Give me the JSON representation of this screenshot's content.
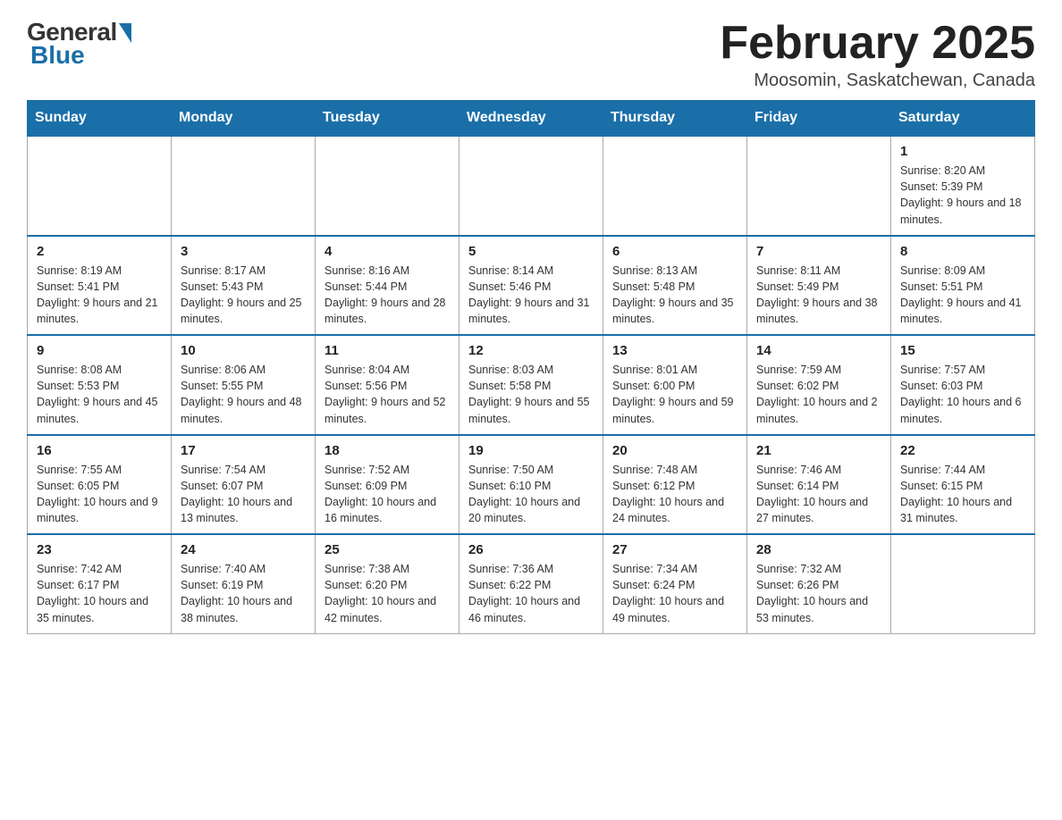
{
  "header": {
    "logo_general": "General",
    "logo_blue": "Blue",
    "month_title": "February 2025",
    "location": "Moosomin, Saskatchewan, Canada"
  },
  "weekdays": [
    "Sunday",
    "Monday",
    "Tuesday",
    "Wednesday",
    "Thursday",
    "Friday",
    "Saturday"
  ],
  "weeks": [
    [
      {
        "day": "",
        "info": ""
      },
      {
        "day": "",
        "info": ""
      },
      {
        "day": "",
        "info": ""
      },
      {
        "day": "",
        "info": ""
      },
      {
        "day": "",
        "info": ""
      },
      {
        "day": "",
        "info": ""
      },
      {
        "day": "1",
        "info": "Sunrise: 8:20 AM\nSunset: 5:39 PM\nDaylight: 9 hours and 18 minutes."
      }
    ],
    [
      {
        "day": "2",
        "info": "Sunrise: 8:19 AM\nSunset: 5:41 PM\nDaylight: 9 hours and 21 minutes."
      },
      {
        "day": "3",
        "info": "Sunrise: 8:17 AM\nSunset: 5:43 PM\nDaylight: 9 hours and 25 minutes."
      },
      {
        "day": "4",
        "info": "Sunrise: 8:16 AM\nSunset: 5:44 PM\nDaylight: 9 hours and 28 minutes."
      },
      {
        "day": "5",
        "info": "Sunrise: 8:14 AM\nSunset: 5:46 PM\nDaylight: 9 hours and 31 minutes."
      },
      {
        "day": "6",
        "info": "Sunrise: 8:13 AM\nSunset: 5:48 PM\nDaylight: 9 hours and 35 minutes."
      },
      {
        "day": "7",
        "info": "Sunrise: 8:11 AM\nSunset: 5:49 PM\nDaylight: 9 hours and 38 minutes."
      },
      {
        "day": "8",
        "info": "Sunrise: 8:09 AM\nSunset: 5:51 PM\nDaylight: 9 hours and 41 minutes."
      }
    ],
    [
      {
        "day": "9",
        "info": "Sunrise: 8:08 AM\nSunset: 5:53 PM\nDaylight: 9 hours and 45 minutes."
      },
      {
        "day": "10",
        "info": "Sunrise: 8:06 AM\nSunset: 5:55 PM\nDaylight: 9 hours and 48 minutes."
      },
      {
        "day": "11",
        "info": "Sunrise: 8:04 AM\nSunset: 5:56 PM\nDaylight: 9 hours and 52 minutes."
      },
      {
        "day": "12",
        "info": "Sunrise: 8:03 AM\nSunset: 5:58 PM\nDaylight: 9 hours and 55 minutes."
      },
      {
        "day": "13",
        "info": "Sunrise: 8:01 AM\nSunset: 6:00 PM\nDaylight: 9 hours and 59 minutes."
      },
      {
        "day": "14",
        "info": "Sunrise: 7:59 AM\nSunset: 6:02 PM\nDaylight: 10 hours and 2 minutes."
      },
      {
        "day": "15",
        "info": "Sunrise: 7:57 AM\nSunset: 6:03 PM\nDaylight: 10 hours and 6 minutes."
      }
    ],
    [
      {
        "day": "16",
        "info": "Sunrise: 7:55 AM\nSunset: 6:05 PM\nDaylight: 10 hours and 9 minutes."
      },
      {
        "day": "17",
        "info": "Sunrise: 7:54 AM\nSunset: 6:07 PM\nDaylight: 10 hours and 13 minutes."
      },
      {
        "day": "18",
        "info": "Sunrise: 7:52 AM\nSunset: 6:09 PM\nDaylight: 10 hours and 16 minutes."
      },
      {
        "day": "19",
        "info": "Sunrise: 7:50 AM\nSunset: 6:10 PM\nDaylight: 10 hours and 20 minutes."
      },
      {
        "day": "20",
        "info": "Sunrise: 7:48 AM\nSunset: 6:12 PM\nDaylight: 10 hours and 24 minutes."
      },
      {
        "day": "21",
        "info": "Sunrise: 7:46 AM\nSunset: 6:14 PM\nDaylight: 10 hours and 27 minutes."
      },
      {
        "day": "22",
        "info": "Sunrise: 7:44 AM\nSunset: 6:15 PM\nDaylight: 10 hours and 31 minutes."
      }
    ],
    [
      {
        "day": "23",
        "info": "Sunrise: 7:42 AM\nSunset: 6:17 PM\nDaylight: 10 hours and 35 minutes."
      },
      {
        "day": "24",
        "info": "Sunrise: 7:40 AM\nSunset: 6:19 PM\nDaylight: 10 hours and 38 minutes."
      },
      {
        "day": "25",
        "info": "Sunrise: 7:38 AM\nSunset: 6:20 PM\nDaylight: 10 hours and 42 minutes."
      },
      {
        "day": "26",
        "info": "Sunrise: 7:36 AM\nSunset: 6:22 PM\nDaylight: 10 hours and 46 minutes."
      },
      {
        "day": "27",
        "info": "Sunrise: 7:34 AM\nSunset: 6:24 PM\nDaylight: 10 hours and 49 minutes."
      },
      {
        "day": "28",
        "info": "Sunrise: 7:32 AM\nSunset: 6:26 PM\nDaylight: 10 hours and 53 minutes."
      },
      {
        "day": "",
        "info": ""
      }
    ]
  ]
}
